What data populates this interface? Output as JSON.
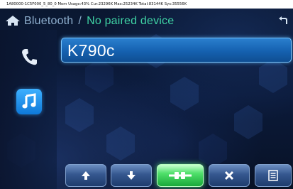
{
  "debug_bar": {
    "text": "1A80000-1C5F000_5_80_0 Mem Usage:43% Cur:23296K Max:25234K Total:83144K Sys:35556K"
  },
  "header": {
    "app_title": "Bluetooth",
    "separator": "/",
    "status": "No paired device",
    "home_icon": "home-icon",
    "back_icon": "back-arrow-icon"
  },
  "sidebar": {
    "items": [
      {
        "name": "phone",
        "icon": "phone-icon",
        "selected": false
      },
      {
        "name": "music",
        "icon": "music-note-icon",
        "selected": true
      }
    ]
  },
  "device_list": {
    "items": [
      {
        "name": "K790c",
        "selected": true
      }
    ]
  },
  "toolbar": {
    "buttons": [
      {
        "name": "up",
        "icon": "arrow-up-icon"
      },
      {
        "name": "down",
        "icon": "arrow-down-icon"
      },
      {
        "name": "connect",
        "icon": "connect-icon",
        "active": true
      },
      {
        "name": "delete",
        "icon": "close-icon"
      },
      {
        "name": "menu",
        "icon": "list-menu-icon"
      }
    ]
  },
  "colors": {
    "accent_blue": "#1f6fc1",
    "status_green": "#3fd2a4",
    "connect_green": "#4fe06a"
  }
}
